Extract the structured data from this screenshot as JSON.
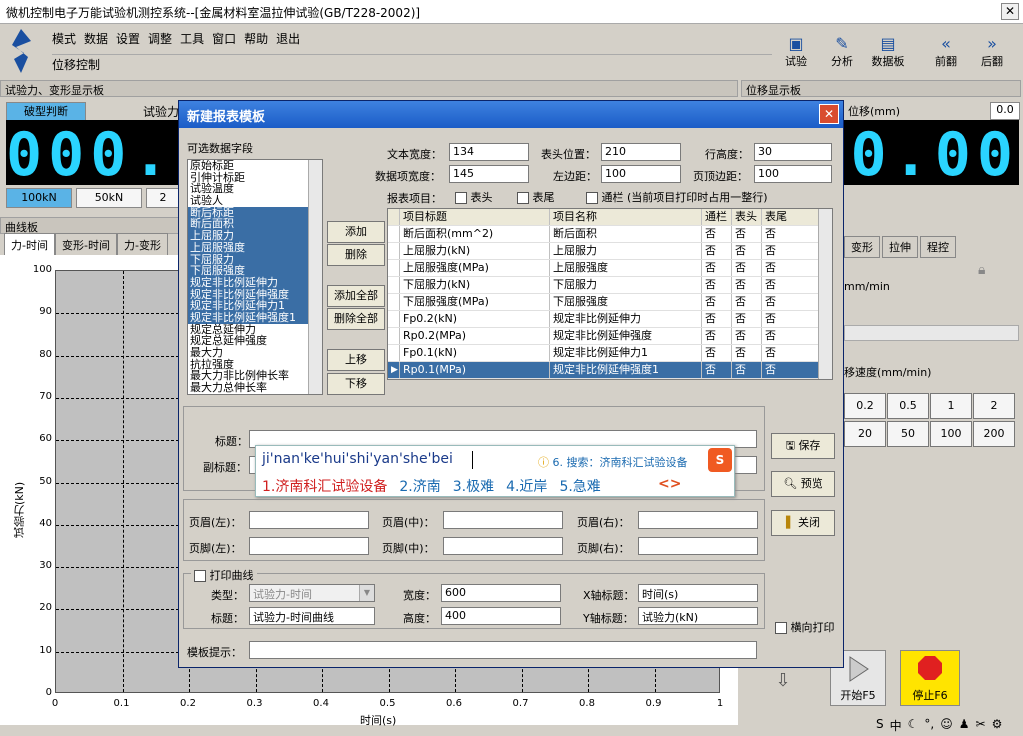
{
  "window": {
    "title": "微机控制电子万能试验机测控系统--[金属材料室温拉伸试验(GB/T228-2002)]",
    "close": "✕"
  },
  "menu": [
    "模式",
    "数据",
    "设置",
    "调整",
    "工具",
    "窗口",
    "帮助",
    "退出"
  ],
  "mode_label": "位移控制",
  "toolbar": [
    {
      "label": "试验",
      "icon": "monitor-icon"
    },
    {
      "label": "分析",
      "icon": "pencil-chart-icon"
    },
    {
      "label": "数据板",
      "icon": "table-icon"
    },
    {
      "label": "前翻",
      "icon": "double-left-icon"
    },
    {
      "label": "后翻",
      "icon": "double-right-icon"
    }
  ],
  "force_panel": {
    "header": "试验力、变形显示板",
    "break_btn": "破型判断",
    "force_label": "试验力",
    "value": "000.0",
    "ranges": [
      "100kN",
      "50kN",
      "2"
    ]
  },
  "disp_panel": {
    "header": "位移显示板",
    "unit": "位移(mm)",
    "value": "0.00",
    "small": "0.0"
  },
  "curve_panel": {
    "header": "曲线板",
    "tabs": [
      "力-时间",
      "变形-时间",
      "力-变形"
    ],
    "ylabel": "试验力(kN)",
    "xlabel": "时间(s)",
    "yticks": [
      "100",
      "90",
      "80",
      "70",
      "60",
      "50",
      "40",
      "30",
      "20",
      "10",
      "0"
    ],
    "xticks": [
      "0",
      "0.1",
      "0.2",
      "0.3",
      "0.4",
      "0.5",
      "0.6",
      "0.7",
      "0.8",
      "0.9",
      "1"
    ]
  },
  "right_panel": {
    "tabs": [
      "变形",
      "拉伸",
      "程控"
    ],
    "unit": "mm/min",
    "speed_label": "移速度(mm/min)",
    "speeds_row1": [
      "0.2",
      "0.5",
      "1",
      "2"
    ],
    "speeds_row2": [
      "20",
      "50",
      "100",
      "200"
    ],
    "start": "开始F5",
    "stop": "停止F6"
  },
  "dialog": {
    "title": "新建报表模板",
    "close": "✕",
    "fields_label": "可选数据字段",
    "fields": [
      "原始标距",
      "引伸计标距",
      "试验温度",
      "试验人",
      "断后标距",
      "断后面积",
      "上屈服力",
      "上屈服强度",
      "下屈服力",
      "下屈服强度",
      "规定非比例延伸力",
      "规定非比例延伸强度",
      "规定非比例延伸力1",
      "规定非比例延伸强度1",
      "规定总延伸力",
      "规定总延伸强度",
      "最大力",
      "抗拉强度",
      "最大力非比例伸长率",
      "最大力总伸长率"
    ],
    "selected_fields": [
      4,
      5,
      6,
      7,
      8,
      9,
      10,
      11,
      12,
      13
    ],
    "text_width_label": "文本宽度：",
    "text_width": "134",
    "header_pos_label": "表头位置：",
    "header_pos": "210",
    "row_height_label": "行高度：",
    "row_height": "30",
    "item_width_label": "数据项宽度：",
    "item_width": "145",
    "left_margin_label": "左边距：",
    "left_margin": "100",
    "top_margin_label": "页顶边距：",
    "top_margin": "100",
    "report_items_label": "报表项目：",
    "chk_header": "表头",
    "chk_footer": "表尾",
    "chk_full": "通栏 (当前项目打印时占用一整行)",
    "btn_add": "添加",
    "btn_delete": "删除",
    "btn_add_all": "添加全部",
    "btn_delete_all": "删除全部",
    "btn_up": "上移",
    "btn_down": "下移",
    "table_headers": [
      "项目标题",
      "项目名称",
      "通栏",
      "表头",
      "表尾"
    ],
    "table_rows": [
      [
        "断后面积(mm^2)",
        "断后面积",
        "否",
        "否",
        "否"
      ],
      [
        "上屈服力(kN)",
        "上屈服力",
        "否",
        "否",
        "否"
      ],
      [
        "上屈服强度(MPa)",
        "上屈服强度",
        "否",
        "否",
        "否"
      ],
      [
        "下屈服力(kN)",
        "下屈服力",
        "否",
        "否",
        "否"
      ],
      [
        "下屈服强度(MPa)",
        "下屈服强度",
        "否",
        "否",
        "否"
      ],
      [
        "Fp0.2(kN)",
        "规定非比例延伸力",
        "否",
        "否",
        "否"
      ],
      [
        "Rp0.2(MPa)",
        "规定非比例延伸强度",
        "否",
        "否",
        "否"
      ],
      [
        "Fp0.1(kN)",
        "规定非比例延伸力1",
        "否",
        "否",
        "否"
      ],
      [
        "Rp0.1(MPa)",
        "规定非比例延伸强度1",
        "否",
        "否",
        "否"
      ]
    ],
    "title_label": "标题：",
    "subtitle_label": "副标题：",
    "btn_save": "保存",
    "btn_preview": "预览",
    "btn_close": "关闭",
    "header_l": "页眉(左)：",
    "header_m": "页眉(中)：",
    "header_r": "页眉(右)：",
    "footer_l": "页脚(左)：",
    "footer_m": "页脚(中)：",
    "footer_r": "页脚(右)：",
    "print_curve": "打印曲线",
    "type_label": "类型：",
    "type_value": "试验力-时间",
    "width_label": "宽度：",
    "width": "600",
    "xtitle_label": "X轴标题：",
    "xtitle": "时间(s)",
    "ctitle_label": "标题：",
    "ctitle": "试验力-时间曲线",
    "height_label": "高度：",
    "height": "400",
    "ytitle_label": "Y轴标题：",
    "ytitle": "试验力(kN)",
    "landscape": "横向打印",
    "hint_label": "模板提示："
  },
  "ime": {
    "input": "ji'nan'ke'hui'shi'yan'she'bei",
    "hint": "6. 搜索：济南科汇试验设备",
    "candidates": [
      "1.济南科汇试验设备",
      "2.济南",
      "3.极难",
      "4.近岸",
      "5.急难"
    ]
  },
  "tray": [
    "S",
    "中",
    "☾",
    "°,",
    "☺",
    "♟",
    "✂",
    "⚙"
  ]
}
